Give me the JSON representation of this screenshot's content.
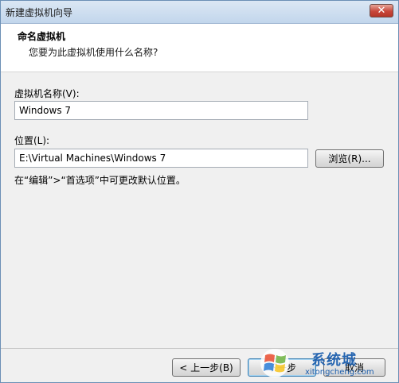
{
  "window": {
    "title": "新建虚拟机向导",
    "close_label": "✕"
  },
  "header": {
    "title": "命名虚拟机",
    "subtitle": "您要为此虚拟机使用什么名称?"
  },
  "vm_name": {
    "label": "虚拟机名称(V):",
    "value": "Windows 7"
  },
  "location": {
    "label": "位置(L):",
    "value": "E:\\Virtual Machines\\Windows 7",
    "browse_label": "浏览(R)..."
  },
  "hint": "在“编辑”>“首选项”中可更改默认位置。",
  "footer": {
    "back_label": "< 上一步(B)",
    "next_label": "下一步",
    "cancel_label": "取消"
  },
  "watermark": {
    "text": "系统城",
    "url": "xitongcheng.com"
  }
}
